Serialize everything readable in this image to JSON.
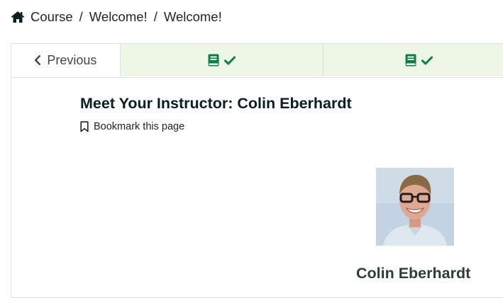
{
  "breadcrumb": {
    "icon": "home-icon",
    "items": [
      "Course",
      "Welcome!",
      "Welcome!"
    ],
    "separator": "/"
  },
  "sequence_nav": {
    "previous_label": "Previous",
    "tabs": [
      {
        "icons": [
          "book-icon",
          "check-icon"
        ],
        "status": "complete"
      },
      {
        "icons": [
          "book-icon",
          "check-icon"
        ],
        "status": "complete"
      }
    ],
    "colors": {
      "tab_bg": "#eef7e5",
      "icon_green": "#0d7d4d"
    }
  },
  "unit": {
    "title": "Meet Your Instructor: Colin Eberhardt",
    "bookmark_label": "Bookmark this page",
    "instructor_name": "Colin Eberhardt",
    "photo_alt": "Colin Eberhardt"
  }
}
